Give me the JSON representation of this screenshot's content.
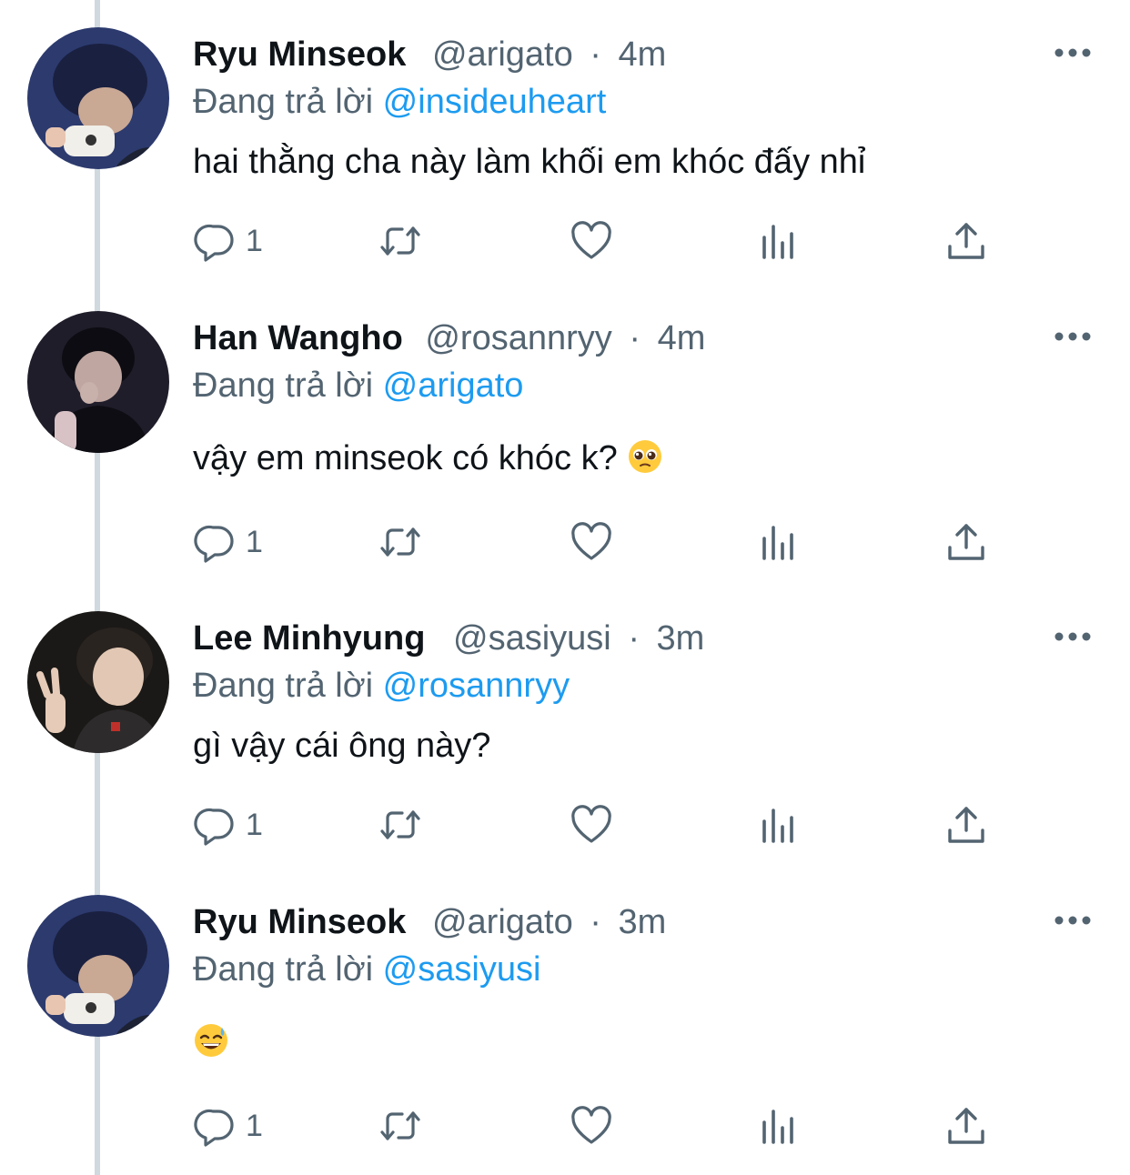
{
  "tweets": [
    {
      "name": "Ryu Minseok",
      "handle": "@arigato",
      "separator": "·",
      "time": "4m",
      "reply_prefix": "Đang trả lời",
      "reply_to": "@insideuheart",
      "text": "hai thằng cha này làm khối em khóc đấy nhỉ",
      "reply_count": "1",
      "avatar_icon": "avatar-ryu-minseok"
    },
    {
      "name": "Han Wangho",
      "handle": "@rosannryy",
      "separator": "·",
      "time": "4m",
      "reply_prefix": "Đang trả lời",
      "reply_to": "@arigato",
      "text": "vậy em minseok có khóc k?",
      "text_emoji": "pleading-face-icon",
      "reply_count": "1",
      "avatar_icon": "avatar-han-wangho"
    },
    {
      "name": "Lee Minhyung",
      "handle": "@sasiyusi",
      "separator": "·",
      "time": "3m",
      "reply_prefix": "Đang trả lời",
      "reply_to": "@rosannryy",
      "text": "gì vậy cái ông này?",
      "reply_count": "1",
      "avatar_icon": "avatar-lee-minhyung"
    },
    {
      "name": "Ryu Minseok",
      "handle": "@arigato",
      "separator": "·",
      "time": "3m",
      "reply_prefix": "Đang trả lời",
      "reply_to": "@sasiyusi",
      "text": "",
      "text_emoji": "grinning-sweat-face-icon",
      "reply_count": "1",
      "avatar_icon": "avatar-ryu-minseok"
    }
  ],
  "colors": {
    "text_primary": "#0f1419",
    "text_secondary": "#536471",
    "mention": "#1d9bf0",
    "thread_line": "#cfd9de",
    "icon": "#536471"
  },
  "icons": {
    "more": "more-dots-icon",
    "reply": "reply-bubble-icon",
    "retweet": "retweet-icon",
    "like": "heart-icon",
    "views": "views-chart-icon",
    "share": "share-upload-icon"
  }
}
